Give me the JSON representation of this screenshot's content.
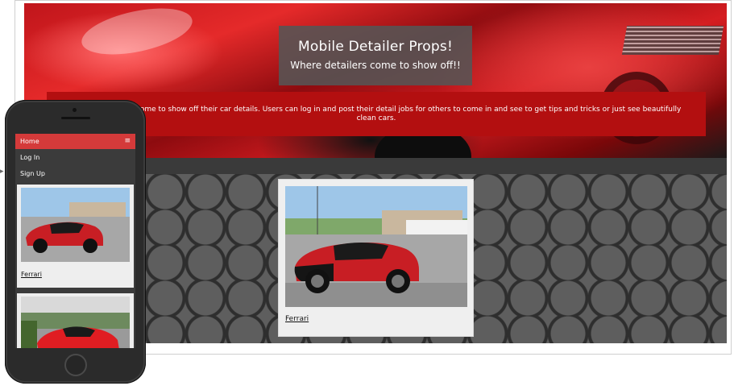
{
  "site": {
    "title": "Mobile Detailer Props!",
    "tagline": "Where detailers come to show off!!",
    "description_visible": "bile detailers can come to show off their car details. Users can log in and post their detail jobs for others to come in and see to get tips and tricks or just see beautifully clean cars."
  },
  "gallery": {
    "items": [
      {
        "caption": "Ferrari",
        "photo": "red-black-bugatti-street-photo"
      }
    ]
  },
  "mobile": {
    "menu": [
      {
        "label": "Home",
        "active": true
      },
      {
        "label": "Log In",
        "active": false
      },
      {
        "label": "Sign Up",
        "active": false
      }
    ],
    "menu_icon": "hamburger-icon",
    "cards": [
      {
        "caption": "Ferrari",
        "photo": "red-black-bugatti-street-photo"
      },
      {
        "caption": "",
        "photo": "red-ferrari-parking-lot-photo"
      }
    ]
  },
  "colors": {
    "accent_red": "#b30f10",
    "menu_red": "#d43a3a",
    "title_box": "#555555",
    "nav_dark": "#3a3a3a"
  }
}
